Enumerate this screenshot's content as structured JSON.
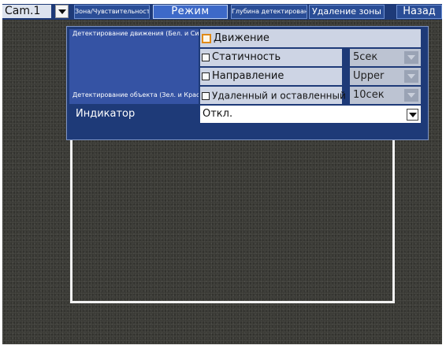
{
  "camera": {
    "selected": "Cam.1"
  },
  "tabs": {
    "zone_sensitivity": "Зона/Чувствительность",
    "mode": "Режим",
    "detection_depth": "Глубина детектирования",
    "zone_delete": "Удаление зоны",
    "back": "Назад"
  },
  "panel": {
    "motion_detection_label": "Детектирование движения (Бел. и Син.)",
    "object_detection_label": "Детектирование объекта (Зел. и Красн.)",
    "indicator_label": "Индикатор",
    "options": {
      "motion": {
        "label": "Движение",
        "checked": false
      },
      "static": {
        "label": "Статичность",
        "checked": false,
        "value": "5сек"
      },
      "direction": {
        "label": "Направление",
        "checked": false,
        "value": "Upper"
      },
      "removed_left": {
        "label": "Удаленный и оставленный",
        "checked": false,
        "value": "10сек"
      }
    },
    "indicator_value": "Откл."
  },
  "colors": {
    "menu_bg": "#1e3a78",
    "active_tab": "#3d69c8",
    "focus_outline": "#e08a18",
    "zone_outline": "#f2f2f2"
  }
}
